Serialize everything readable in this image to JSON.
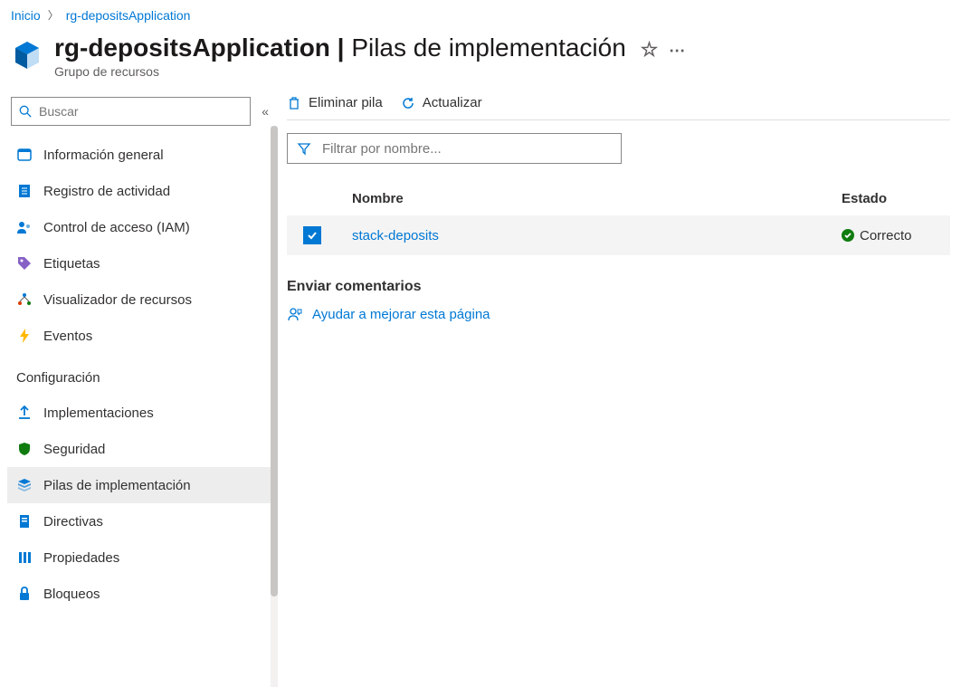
{
  "breadcrumb": {
    "home": "Inicio",
    "current": "rg-depositsApplication"
  },
  "header": {
    "resource_name": "rg-depositsApplication",
    "page_title": "Pilas de implementación",
    "subtitle": "Grupo de recursos"
  },
  "sidebar": {
    "search_placeholder": "Buscar",
    "items": [
      {
        "label": "Información general",
        "icon": "overview"
      },
      {
        "label": "Registro de actividad",
        "icon": "log"
      },
      {
        "label": "Control de acceso (IAM)",
        "icon": "iam"
      },
      {
        "label": "Etiquetas",
        "icon": "tags"
      },
      {
        "label": "Visualizador de recursos",
        "icon": "visualizer"
      },
      {
        "label": "Eventos",
        "icon": "events"
      }
    ],
    "section": "Configuración",
    "config_items": [
      {
        "label": "Implementaciones",
        "icon": "deploy"
      },
      {
        "label": "Seguridad",
        "icon": "security"
      },
      {
        "label": "Pilas de implementación",
        "icon": "stack",
        "selected": true
      },
      {
        "label": "Directivas",
        "icon": "policy"
      },
      {
        "label": "Propiedades",
        "icon": "props"
      },
      {
        "label": "Bloqueos",
        "icon": "locks"
      }
    ]
  },
  "toolbar": {
    "delete": "Eliminar pila",
    "refresh": "Actualizar"
  },
  "filter_placeholder": "Filtrar por nombre...",
  "table": {
    "col_name": "Nombre",
    "col_status": "Estado",
    "rows": [
      {
        "name": "stack-deposits",
        "status": "Correcto",
        "checked": true
      }
    ]
  },
  "feedback": {
    "title": "Enviar comentarios",
    "link": "Ayudar a mejorar esta página"
  }
}
